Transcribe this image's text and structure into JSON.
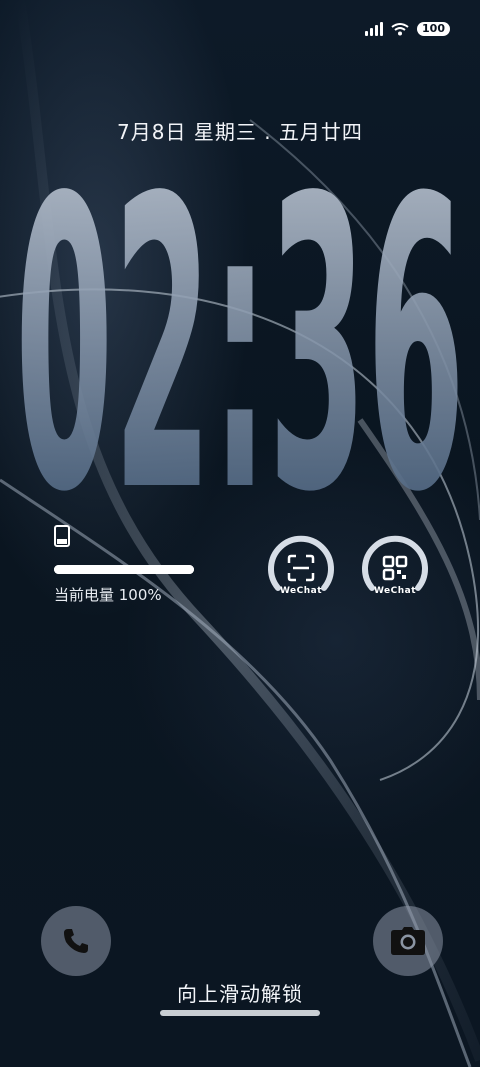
{
  "status_bar": {
    "battery_level": "100",
    "signal_icon": "signal-icon",
    "wifi_icon": "wifi-icon"
  },
  "lockscreen": {
    "date_text": "7月8日 星期三 . 五月廿四",
    "time": "02:36"
  },
  "battery_widget": {
    "label": "当前电量 100%",
    "level_fraction": 1.0,
    "icon": "phone-icon"
  },
  "shortcuts": [
    {
      "label": "WeChat",
      "icon": "scan-icon"
    },
    {
      "label": "WeChat",
      "icon": "qr-code-icon"
    }
  ],
  "bottom": {
    "left_icon": "phone-call-icon",
    "right_icon": "camera-icon",
    "unlock_hint": "向上滑动解锁"
  },
  "colors": {
    "accent": "#ffffff",
    "background": "#0b1420",
    "clock_top": "#b8c2cf",
    "clock_bottom": "#3a5472"
  }
}
